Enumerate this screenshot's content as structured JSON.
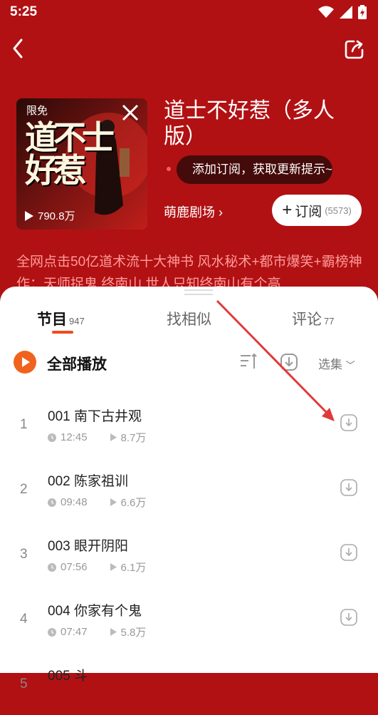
{
  "status": {
    "time": "5:25"
  },
  "cover": {
    "tag": "限免",
    "title_art": "道不士好惹",
    "plays": "790.8万"
  },
  "book": {
    "title": "道士不好惹（多人版）",
    "anchor": "萌鹿剧场",
    "tooltip": "添加订阅，获取更新提示~",
    "subscribe_label": "订阅",
    "subscribe_count": "(5573)",
    "description": "全网点击50亿道术流十大神书 风水秘术+都市爆笑+霸榜神作：天师捉鬼 终南山 世人只知终南山有个高"
  },
  "tabs": [
    {
      "label": "节目",
      "count": "947"
    },
    {
      "label": "找相似",
      "count": ""
    },
    {
      "label": "评论",
      "count": "77"
    }
  ],
  "toolbar": {
    "play_all": "全部播放",
    "select": "选集"
  },
  "episodes": [
    {
      "index": "1",
      "title": "001 南下古井观",
      "duration": "12:45",
      "plays": "8.7万"
    },
    {
      "index": "2",
      "title": "002 陈家祖训",
      "duration": "09:48",
      "plays": "6.6万"
    },
    {
      "index": "3",
      "title": "003 眼开阴阳",
      "duration": "07:56",
      "plays": "6.1万"
    },
    {
      "index": "4",
      "title": "004 你家有个鬼",
      "duration": "07:47",
      "plays": "5.8万"
    },
    {
      "index": "5",
      "title": "005 斗",
      "duration": "",
      "plays": ""
    }
  ],
  "colors": {
    "header_bg": "#b11113",
    "accent": "#f04a1d",
    "annotation_arrow": "#e03a3a"
  },
  "icons": [
    "back-arrow-icon",
    "share-icon",
    "wifi-icon",
    "signal-icon",
    "battery-icon",
    "play-icon",
    "sort-icon",
    "download-icon",
    "clock-icon",
    "chevron-down-icon"
  ]
}
